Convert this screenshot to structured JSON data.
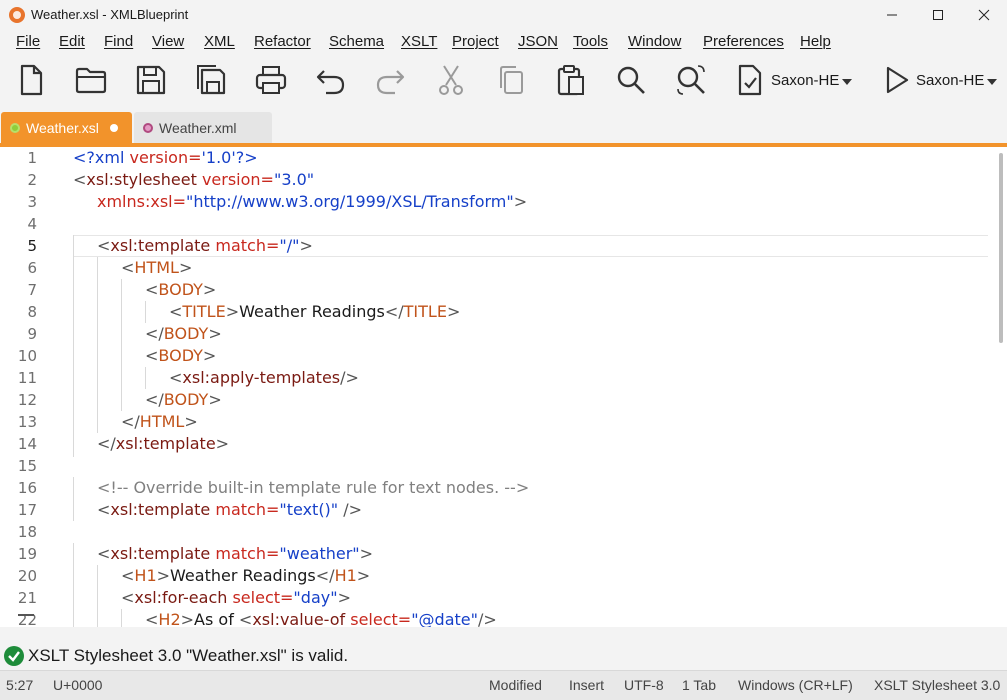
{
  "window": {
    "title": "Weather.xsl - XMLBlueprint"
  },
  "menu": [
    "File",
    "Edit",
    "Find",
    "View",
    "XML",
    "Refactor",
    "Schema",
    "XSLT",
    "Project",
    "JSON",
    "Tools",
    "Window",
    "Preferences",
    "Help"
  ],
  "toolbar": {
    "icons": [
      "new-file",
      "open-folder",
      "save",
      "save-all",
      "print",
      "undo",
      "redo",
      "cut",
      "copy",
      "paste",
      "find",
      "find-replace",
      "validate",
      "run"
    ],
    "validate_engine": "Saxon-HE",
    "run_engine": "Saxon-HE"
  },
  "tabs": [
    {
      "label": "Weather.xsl",
      "active": true,
      "modified": true
    },
    {
      "label": "Weather.xml",
      "active": false,
      "modified": false
    }
  ],
  "editor": {
    "line_numbers": [
      "1",
      "2",
      "3",
      "4",
      "5",
      "6",
      "7",
      "8",
      "9",
      "10",
      "11",
      "12",
      "13",
      "14",
      "15",
      "16",
      "17",
      "18",
      "19",
      "20",
      "21",
      "22"
    ],
    "current_line": 5,
    "lines": [
      [
        {
          "t": "<?xml ",
          "c": "bl"
        },
        {
          "t": "version=",
          "c": "rd"
        },
        {
          "t": "'1.0'",
          "c": "bl"
        },
        {
          "t": "?>",
          "c": "bl"
        }
      ],
      [
        {
          "t": "<",
          "c": "ga"
        },
        {
          "t": "xsl:stylesheet ",
          "c": "dr"
        },
        {
          "t": "version=",
          "c": "rd"
        },
        {
          "t": "\"3.0\"",
          "c": "bl"
        }
      ],
      [
        {
          "t": "xmlns:xsl=",
          "c": "rd"
        },
        {
          "t": "\"http://www.w3.org/1999/XSL/Transform\"",
          "c": "bl"
        },
        {
          "t": ">",
          "c": "ga"
        }
      ],
      [],
      [
        {
          "t": "<",
          "c": "ga"
        },
        {
          "t": "xsl:template ",
          "c": "dr"
        },
        {
          "t": "match=",
          "c": "rd"
        },
        {
          "t": "\"/\"",
          "c": "bl"
        },
        {
          "t": ">",
          "c": "ga"
        }
      ],
      [
        {
          "t": "<",
          "c": "ga"
        },
        {
          "t": "HTML",
          "c": "or"
        },
        {
          "t": ">",
          "c": "ga"
        }
      ],
      [
        {
          "t": "<",
          "c": "ga"
        },
        {
          "t": "BODY",
          "c": "or"
        },
        {
          "t": ">",
          "c": "ga"
        }
      ],
      [
        {
          "t": "<",
          "c": "ga"
        },
        {
          "t": "TITLE",
          "c": "or"
        },
        {
          "t": ">",
          "c": "ga"
        },
        {
          "t": "Weather Readings",
          "c": "tx"
        },
        {
          "t": "</",
          "c": "ga"
        },
        {
          "t": "TITLE",
          "c": "or"
        },
        {
          "t": ">",
          "c": "ga"
        }
      ],
      [
        {
          "t": "</",
          "c": "ga"
        },
        {
          "t": "BODY",
          "c": "or"
        },
        {
          "t": ">",
          "c": "ga"
        }
      ],
      [
        {
          "t": "<",
          "c": "ga"
        },
        {
          "t": "BODY",
          "c": "or"
        },
        {
          "t": ">",
          "c": "ga"
        }
      ],
      [
        {
          "t": "<",
          "c": "ga"
        },
        {
          "t": "xsl:apply-templates",
          "c": "dr"
        },
        {
          "t": "/>",
          "c": "ga"
        }
      ],
      [
        {
          "t": "</",
          "c": "ga"
        },
        {
          "t": "BODY",
          "c": "or"
        },
        {
          "t": ">",
          "c": "ga"
        }
      ],
      [
        {
          "t": "</",
          "c": "ga"
        },
        {
          "t": "HTML",
          "c": "or"
        },
        {
          "t": ">",
          "c": "ga"
        }
      ],
      [
        {
          "t": "</",
          "c": "ga"
        },
        {
          "t": "xsl:template",
          "c": "dr"
        },
        {
          "t": ">",
          "c": "ga"
        }
      ],
      [],
      [
        {
          "t": "<!-- Override built-in template rule for text nodes. -->",
          "c": "cm"
        }
      ],
      [
        {
          "t": "<",
          "c": "ga"
        },
        {
          "t": "xsl:template ",
          "c": "dr"
        },
        {
          "t": "match=",
          "c": "rd"
        },
        {
          "t": "\"text()\"",
          "c": "bl"
        },
        {
          "t": " />",
          "c": "ga"
        }
      ],
      [],
      [
        {
          "t": "<",
          "c": "ga"
        },
        {
          "t": "xsl:template ",
          "c": "dr"
        },
        {
          "t": "match=",
          "c": "rd"
        },
        {
          "t": "\"weather\"",
          "c": "bl"
        },
        {
          "t": ">",
          "c": "ga"
        }
      ],
      [
        {
          "t": "<",
          "c": "ga"
        },
        {
          "t": "H1",
          "c": "or"
        },
        {
          "t": ">",
          "c": "ga"
        },
        {
          "t": "Weather Readings",
          "c": "tx"
        },
        {
          "t": "</",
          "c": "ga"
        },
        {
          "t": "H1",
          "c": "or"
        },
        {
          "t": ">",
          "c": "ga"
        }
      ],
      [
        {
          "t": "<",
          "c": "ga"
        },
        {
          "t": "xsl:for-each ",
          "c": "dr"
        },
        {
          "t": "select=",
          "c": "rd"
        },
        {
          "t": "\"day\"",
          "c": "bl"
        },
        {
          "t": ">",
          "c": "ga"
        }
      ],
      [
        {
          "t": "<",
          "c": "ga"
        },
        {
          "t": "H2",
          "c": "or"
        },
        {
          "t": ">",
          "c": "ga"
        },
        {
          "t": "As of ",
          "c": "tx"
        },
        {
          "t": "<",
          "c": "ga"
        },
        {
          "t": "xsl:value-of ",
          "c": "dr"
        },
        {
          "t": "select=",
          "c": "rd"
        },
        {
          "t": "\"@date\"",
          "c": "bl"
        },
        {
          "t": "/>",
          "c": "ga"
        }
      ]
    ]
  },
  "message": {
    "text": "XSLT Stylesheet 3.0 \"Weather.xsl\" is valid.",
    "status": "valid",
    "color": "#1e8c3a"
  },
  "status": {
    "position": "5:27",
    "codepoint": "U+0000",
    "modified": "Modified",
    "mode": "Insert",
    "encoding": "UTF-8",
    "indent": "1 Tab",
    "line_ending": "Windows (CR+LF)",
    "doc_type": "XSLT Stylesheet 3.0"
  },
  "colors": {
    "accent": "#f2932b"
  }
}
